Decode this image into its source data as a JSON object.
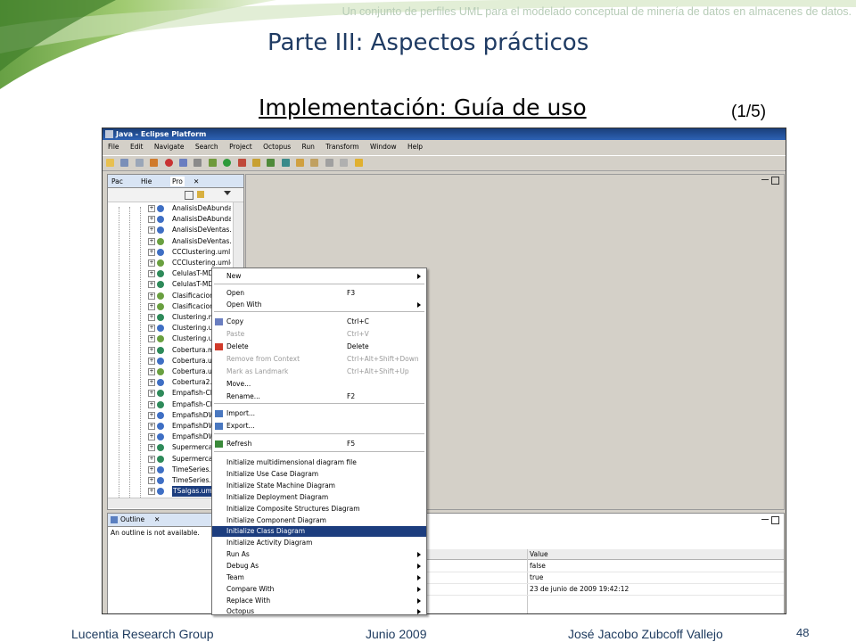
{
  "slide": {
    "header_text": "Un conjunto de perfiles UML para el modelado conceptual de minería de datos en almacenes de datos.",
    "title": "Parte III: Aspectos prácticos",
    "subtitle": "Implementación: Guía de uso",
    "counter": "(1/5)",
    "footer_left": "Lucentia Research Group",
    "footer_center": "Junio  2009",
    "footer_right": "José Jacobo Zubcoff Vallejo",
    "page_number": "48"
  },
  "colors": {
    "accent_green": "#7fb24a",
    "title_blue": "#1f3b63",
    "menu_selected": "#1c3d7e"
  },
  "window": {
    "title": "Java - Eclipse Platform",
    "menus": [
      "File",
      "Edit",
      "Navigate",
      "Search",
      "Project",
      "Octopus",
      "Run",
      "Transform",
      "Window",
      "Help"
    ]
  },
  "explorer": {
    "tabs": [
      "Pac",
      "Hie",
      "Pro"
    ],
    "files": [
      "AnalisisDeAbundan",
      "AnalisisDeAbundan",
      "AnalisisDeVentas.u",
      "AnalisisDeVentas.u",
      "CCClustering.uml",
      "CCClustering.umlcl",
      "CelulasT-MD",
      "CelulasT-MD",
      "Clasificacion",
      "Clasificacion",
      "Clustering.m",
      "Clustering.ur",
      "Clustering.ur",
      "Cobertura.m",
      "Cobertura.ur",
      "Cobertura.ur",
      "Cobertura2.",
      "Empafish-Cla",
      "Empafish-Cla",
      "EmpafishDW",
      "EmpafishDW",
      "EmpafishDW",
      "Supermercad",
      "Supermercad",
      "TimeSeries.u",
      "TimeSeries.u",
      "TSalgas.uml"
    ]
  },
  "outline": {
    "tab": "Outline",
    "message": "An outline is not available."
  },
  "properties": {
    "value_header": "Value",
    "values": [
      "false",
      "true",
      "23 de junio de 2009 19:42:12"
    ]
  },
  "context_menu": {
    "items": [
      {
        "label": "New",
        "submenu": true
      },
      {
        "label": "Open",
        "shortcut": "F3"
      },
      {
        "label": "Open With",
        "submenu": true
      },
      {
        "label": "Copy",
        "shortcut": "Ctrl+C",
        "icon": "copy-icon"
      },
      {
        "label": "Paste",
        "shortcut": "Ctrl+V",
        "disabled": true
      },
      {
        "label": "Delete",
        "shortcut": "Delete",
        "icon": "delete-icon"
      },
      {
        "label": "Remove from Context",
        "shortcut": "Ctrl+Alt+Shift+Down",
        "disabled": true
      },
      {
        "label": "Mark as Landmark",
        "shortcut": "Ctrl+Alt+Shift+Up",
        "disabled": true
      },
      {
        "label": "Move..."
      },
      {
        "label": "Rename...",
        "shortcut": "F2"
      },
      {
        "label": "Import...",
        "icon": "import-icon"
      },
      {
        "label": "Export...",
        "icon": "export-icon"
      },
      {
        "label": "Refresh",
        "shortcut": "F5",
        "icon": "refresh-icon"
      },
      {
        "label": "Initialize multidimensional diagram file"
      },
      {
        "label": "Initialize Use Case Diagram"
      },
      {
        "label": "Initialize State Machine Diagram"
      },
      {
        "label": "Initialize Deployment Diagram"
      },
      {
        "label": "Initialize Composite Structures Diagram"
      },
      {
        "label": "Initialize Component Diagram"
      },
      {
        "label": "Initialize Class Diagram",
        "selected": true
      },
      {
        "label": "Initialize Activity Diagram"
      },
      {
        "label": "Run As",
        "submenu": true
      },
      {
        "label": "Debug As",
        "submenu": true
      },
      {
        "label": "Team",
        "submenu": true
      },
      {
        "label": "Compare With",
        "submenu": true
      },
      {
        "label": "Replace With",
        "submenu": true
      },
      {
        "label": "Octopus",
        "submenu": true
      }
    ]
  }
}
